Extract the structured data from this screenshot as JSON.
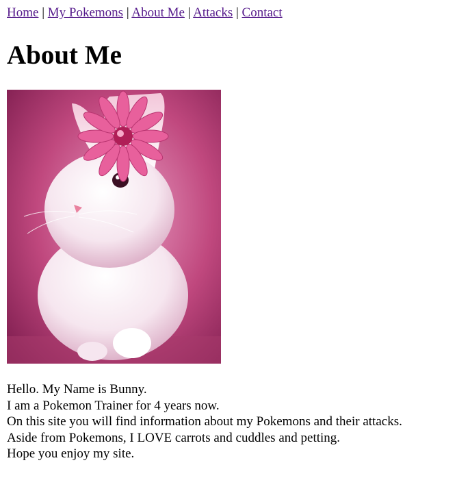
{
  "nav": {
    "links": [
      "Home",
      "My Pokemons",
      "About Me",
      "Attacks",
      "Contact"
    ],
    "separator": "|",
    "link_color": "#551a8b"
  },
  "page": {
    "title": "About Me"
  },
  "photo": {
    "subject": "white-bunny-with-pink-flower",
    "background_color": "#c0487e",
    "flower_color": "#e8609c"
  },
  "bio": {
    "lines": [
      "Hello. My Name is Bunny.",
      "I am a Pokemon Trainer for 4 years now.",
      "On this site you will find information about my Pokemons and their attacks.",
      "Aside from Pokemons, I LOVE carrots and cuddles and petting.",
      "Hope you enjoy my site."
    ]
  }
}
